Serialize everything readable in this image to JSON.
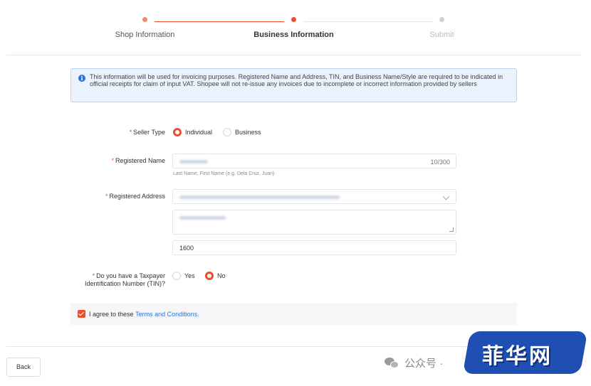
{
  "stepper": {
    "steps": [
      {
        "label": "Shop Information",
        "state": "done"
      },
      {
        "label": "Business Information",
        "state": "active"
      },
      {
        "label": "Submit",
        "state": "pending"
      }
    ]
  },
  "info_banner": {
    "icon": "info-icon",
    "text": "This information will be used for invoicing purposes. Registered Name and Address, TIN, and Business Name/Style are required to be indicated in official receipts for claim of input VAT. Shopee will not re-issue any invoices due to incomplete or incorrect information provided by sellers"
  },
  "form": {
    "seller_type": {
      "label": "Seller Type",
      "options": [
        "Individual",
        "Business"
      ],
      "selected": "Individual"
    },
    "registered_name": {
      "label": "Registered Name",
      "counter": "10/300",
      "hint": "Last Name, First Name (e.g. Dela Cruz, Juan)"
    },
    "registered_address": {
      "label": "Registered Address",
      "zip": "1600"
    },
    "tin": {
      "label_line1": "Do you have a Taxpayer",
      "label_line2": "Identification Number (TIN)?",
      "options": [
        "Yes",
        "No"
      ],
      "selected": "No"
    },
    "terms": {
      "text": "I agree to these",
      "link": "Terms and Conditions.",
      "checked": true
    }
  },
  "footer": {
    "back_label": "Back"
  },
  "watermarks": {
    "wechat_text": "公众号 ·",
    "logo_text": "菲华网"
  },
  "colors": {
    "accent": "#ee4d2d",
    "link": "#2673dd",
    "info_bg": "#eaf3fd"
  }
}
